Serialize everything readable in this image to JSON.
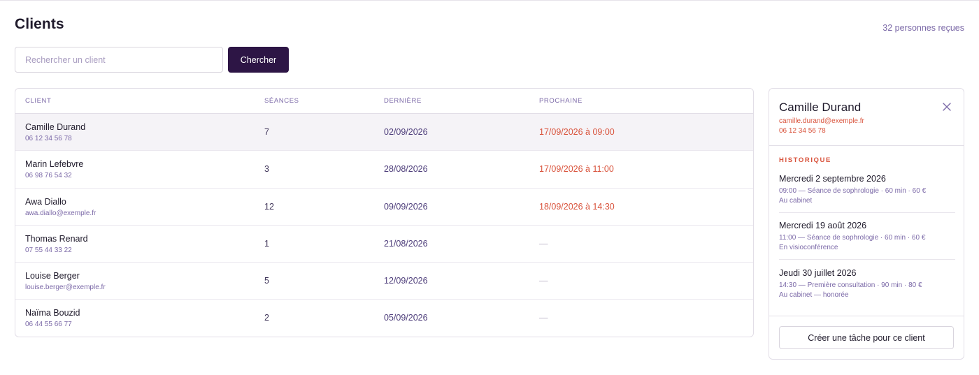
{
  "page": {
    "title": "Clients",
    "people_count": "32 personnes reçues"
  },
  "search": {
    "placeholder": "Rechercher un client",
    "value": "",
    "button_label": "Chercher"
  },
  "table": {
    "columns": [
      "Client",
      "Séances",
      "Dernière",
      "Prochaine"
    ],
    "rows": [
      {
        "name": "Camille Durand",
        "contact": "06 12 34 56 78",
        "sessions": "7",
        "last": "02/09/2026",
        "next": "17/09/2026 à 09:00",
        "selected": true
      },
      {
        "name": "Marin Lefebvre",
        "contact": "06 98 76 54 32",
        "sessions": "3",
        "last": "28/08/2026",
        "next": "17/09/2026 à 11:00",
        "selected": false
      },
      {
        "name": "Awa Diallo",
        "contact": "awa.diallo@exemple.fr",
        "sessions": "12",
        "last": "09/09/2026",
        "next": "18/09/2026 à 14:30",
        "selected": false
      },
      {
        "name": "Thomas Renard",
        "contact": "07 55 44 33 22",
        "sessions": "1",
        "last": "21/08/2026",
        "next": "—",
        "selected": false
      },
      {
        "name": "Louise Berger",
        "contact": "louise.berger@exemple.fr",
        "sessions": "5",
        "last": "12/09/2026",
        "next": "—",
        "selected": false
      },
      {
        "name": "Naïma Bouzid",
        "contact": "06 44 55 66 77",
        "sessions": "2",
        "last": "05/09/2026",
        "next": "—",
        "selected": false
      }
    ]
  },
  "detail": {
    "name": "Camille Durand",
    "email": "camille.durand@exemple.fr",
    "phone": "06 12 34 56 78",
    "history_title": "HISTORIQUE",
    "history": [
      {
        "date": "Mercredi 2 septembre 2026",
        "info": "09:00 — Séance de sophrologie · 60 min · 60 €",
        "place": "Au cabinet"
      },
      {
        "date": "Mercredi 19 août 2026",
        "info": "11:00 — Séance de sophrologie · 60 min · 60 €",
        "place": "En visioconférence"
      },
      {
        "date": "Jeudi 30 juillet 2026",
        "info": "14:30 — Première consultation · 90 min · 80 €",
        "place": "Au cabinet — honorée"
      }
    ],
    "task_button_label": "Créer une tâche pour ce client"
  },
  "icons": {
    "close": "close-icon"
  },
  "colors": {
    "primary": "#2d1545",
    "accent_orange": "#d9533c",
    "muted_purple": "#7c6aa8"
  }
}
